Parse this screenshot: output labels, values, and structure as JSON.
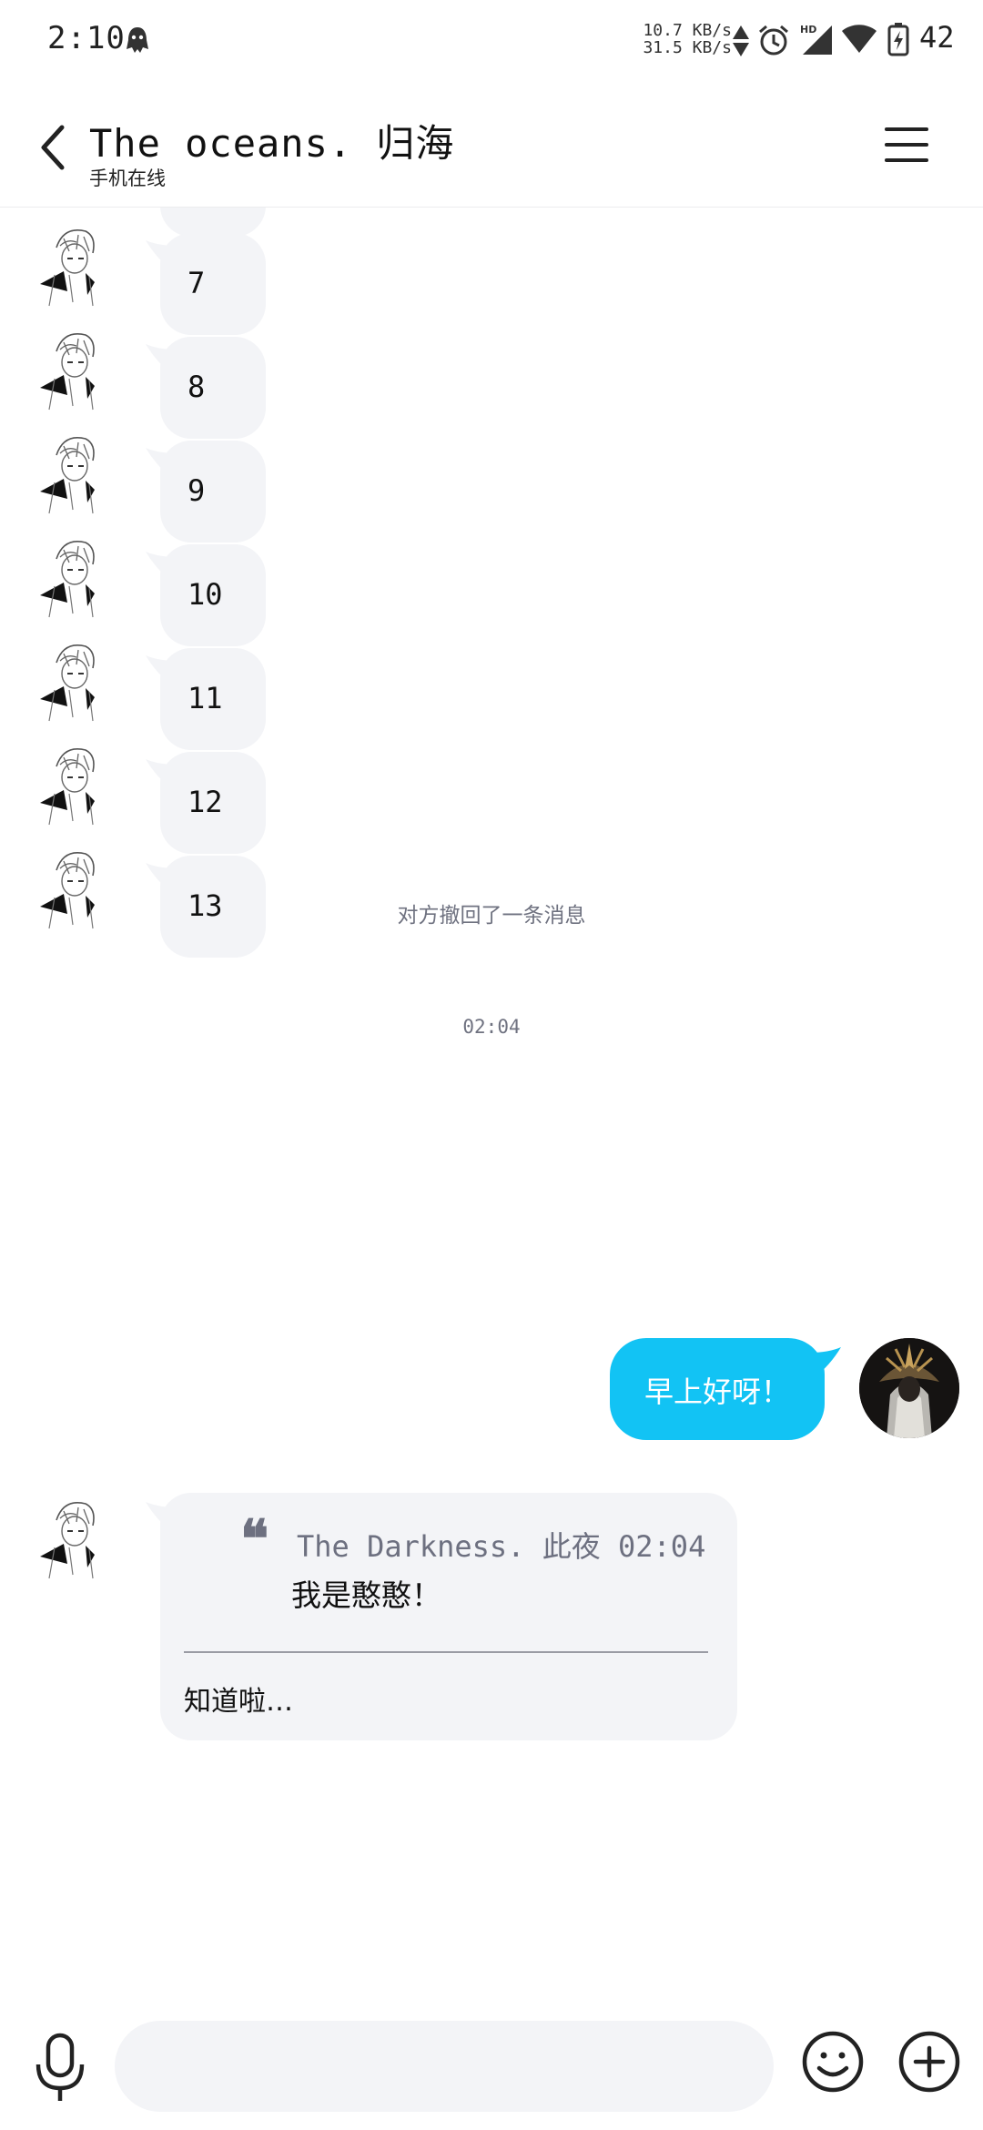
{
  "status_bar": {
    "time": "2:10",
    "net_speed_down": "10.7 KB/s",
    "net_speed_up": "31.5 KB/s",
    "network_type": "HD",
    "battery_level": "42",
    "icons": [
      "app-notification-icon",
      "network-activity-icon",
      "alarm-icon",
      "hd-signal-icon",
      "wifi-icon",
      "battery-charging-icon"
    ]
  },
  "header": {
    "title": "The oceans. 归海",
    "subtitle": "手机在线",
    "back_icon": "chevron-left-icon",
    "menu_icon": "hamburger-menu-icon"
  },
  "messages": {
    "number_bubbles": [
      "7",
      "8",
      "9",
      "10",
      "11",
      "12",
      "13"
    ],
    "recalled_notice": "对方撤回了一条消息",
    "timestamp": "02:04",
    "outgoing_text": "早上好呀！",
    "reply": {
      "quote_author": "The Darkness. 此夜",
      "quote_time": "02:04",
      "quote_text": "我是憨憨！",
      "text": "知道啦…"
    }
  },
  "input_bar": {
    "placeholder": "",
    "value": "",
    "icons": [
      "microphone-icon",
      "emoji-icon",
      "plus-icon"
    ]
  },
  "colors": {
    "outgoing_bubble": "#12c3f4",
    "incoming_bubble": "#f3f4f7",
    "secondary_text": "#6f7280",
    "background": "#ffffff"
  }
}
